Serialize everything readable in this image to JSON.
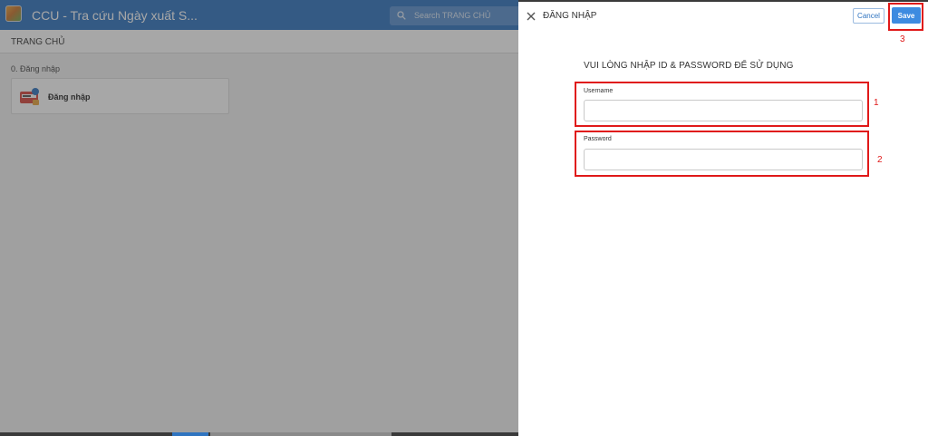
{
  "app": {
    "title": "CCU - Tra cứu Ngày xuất S...",
    "search_placeholder": "Search TRANG CHỦ",
    "subtitle": "TRANG CHỦ",
    "section_label": "0. Đăng nhập",
    "tile_label": "Đăng nhập"
  },
  "panel": {
    "title": "ĐĂNG NHẬP",
    "cancel_label": "Cancel",
    "save_label": "Save",
    "instruction": "VUI LÒNG NHẬP ID & PASSWORD ĐỂ SỬ DỤNG",
    "username_label": "Username",
    "username_value": "",
    "password_label": "Password",
    "password_value": ""
  },
  "annotations": {
    "one": "1",
    "two": "2",
    "three": "3"
  },
  "colors": {
    "header_blue": "#2f74c0",
    "save_blue": "#3d8be0",
    "annotation_red": "#e01919"
  }
}
